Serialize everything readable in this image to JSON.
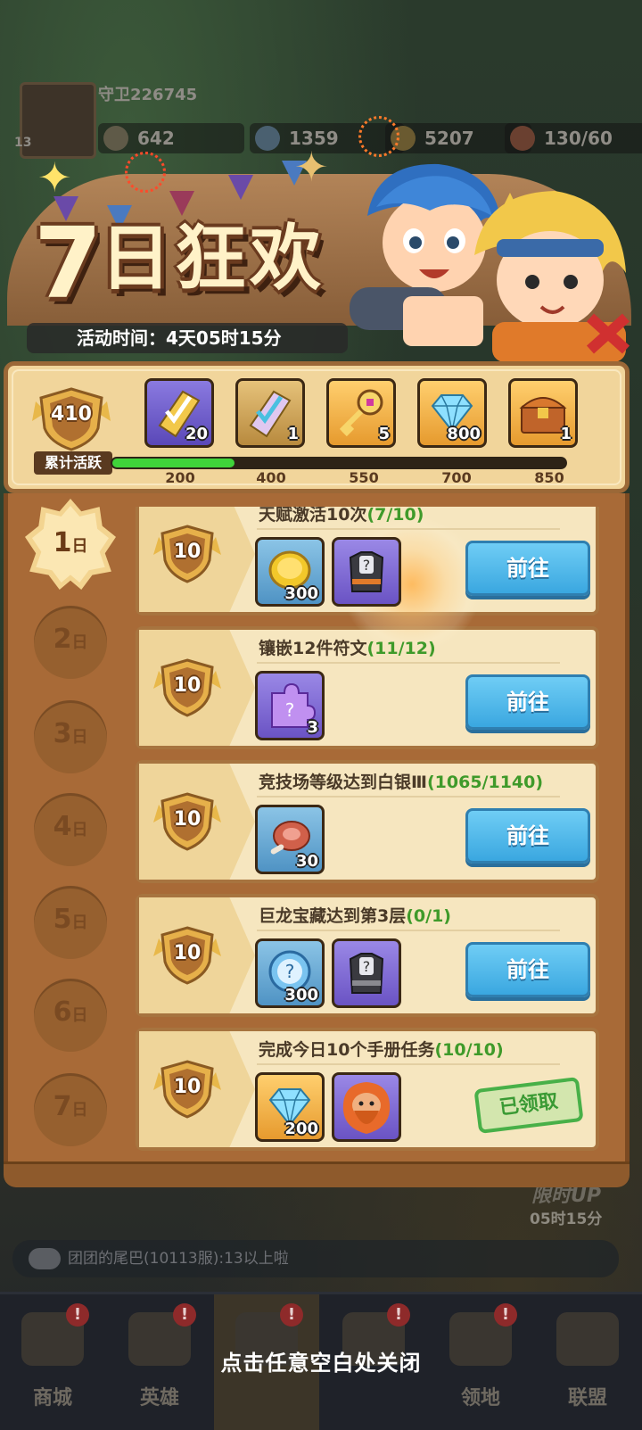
{
  "hud": {
    "player_name": "守卫226745",
    "level": "13",
    "power": "642",
    "gems": "1359",
    "gold": "5207",
    "stamina": "130/60"
  },
  "banner": {
    "title_number": "7",
    "title_rest": "日狂欢",
    "timer_label": "活动时间：4天05时15分"
  },
  "rewards": {
    "points": "410",
    "points_label": "累计活跃",
    "progress_fraction": 0.27,
    "milestones": [
      {
        "icon": "yellow-scroll-icon",
        "count": "20",
        "label": "200",
        "color": "purple"
      },
      {
        "icon": "rainbow-scroll-icon",
        "count": "1",
        "label": "400",
        "color": "gold"
      },
      {
        "icon": "key-icon",
        "count": "5",
        "label": "550",
        "color": "gold"
      },
      {
        "icon": "diamond-icon",
        "count": "800",
        "label": "700",
        "color": "gold"
      },
      {
        "icon": "treasure-chest-icon",
        "count": "1",
        "label": "850",
        "color": "gold"
      }
    ]
  },
  "days": [
    "1",
    "2",
    "3",
    "4",
    "5",
    "6",
    "7"
  ],
  "day_suffix": "日",
  "tasks": [
    {
      "title": "天赋激活10次",
      "progress": "(7/10)",
      "points": "10",
      "items": [
        {
          "icon": "gold-coin-icon",
          "count": "300",
          "color": "blue"
        },
        {
          "icon": "mystery-armor-icon",
          "count": "",
          "color": "purple"
        }
      ],
      "action": "前往"
    },
    {
      "title": "镶嵌12件符文",
      "progress": "(11/12)",
      "points": "10",
      "items": [
        {
          "icon": "purple-puzzle-icon",
          "count": "3",
          "color": "purple"
        }
      ],
      "action": "前往"
    },
    {
      "title": "竞技场等级达到白银Ⅲ",
      "progress": "(1065/1140)",
      "points": "10",
      "items": [
        {
          "icon": "meat-icon",
          "count": "30",
          "color": "blue"
        }
      ],
      "action": "前往"
    },
    {
      "title": "巨龙宝藏达到第3层",
      "progress": "(0/1)",
      "points": "10",
      "items": [
        {
          "icon": "mystery-orb-icon",
          "count": "300",
          "color": "blue"
        },
        {
          "icon": "mystery-armor-icon",
          "count": "",
          "color": "purple"
        }
      ],
      "action": "前往"
    },
    {
      "title": "完成今日10个手册任务",
      "progress": "(10/10)",
      "points": "10",
      "items": [
        {
          "icon": "diamond-icon",
          "count": "200",
          "color": "gold"
        },
        {
          "icon": "hero-portrait-icon",
          "count": "",
          "color": "purple"
        }
      ],
      "claimed": "已领取"
    }
  ],
  "limited": {
    "title": "限时UP",
    "timer": "05时15分"
  },
  "chat": "团团的尾巴(10113服):13以上啦",
  "nav": [
    {
      "label": "商城"
    },
    {
      "label": "英雄"
    },
    {
      "label": ""
    },
    {
      "label": ""
    },
    {
      "label": "领地"
    },
    {
      "label": "联盟"
    }
  ],
  "close_hint": "点击任意空白处关闭"
}
